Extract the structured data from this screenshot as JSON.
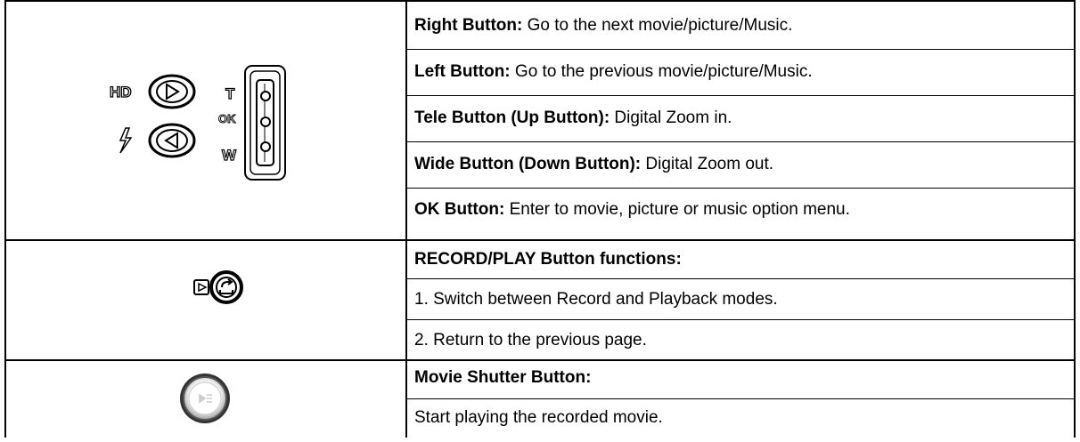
{
  "rows": [
    {
      "icon": {
        "hd_label": "HD",
        "t_label": "T",
        "ok_label": "OK",
        "w_label": "W"
      },
      "lines": [
        {
          "label": "Right Button:",
          "text": " Go to the next movie/picture/Music."
        },
        {
          "label": "Left Button:",
          "text": " Go to the previous movie/picture/Music."
        },
        {
          "label": "Tele Button (Up Button):",
          "text": " Digital Zoom in."
        },
        {
          "label": "Wide Button (Down Button):",
          "text": " Digital Zoom out."
        },
        {
          "label": "OK Button:",
          "text": " Enter to movie, picture or music option menu."
        }
      ]
    },
    {
      "lines": [
        {
          "label": "RECORD/PLAY Button functions:",
          "text": ""
        },
        {
          "label": "",
          "text": "1. Switch between Record and Playback modes."
        },
        {
          "label": "",
          "text": "2. Return to the previous page."
        }
      ]
    },
    {
      "lines": [
        {
          "label": "Movie Shutter Button:",
          "text": ""
        },
        {
          "label": "",
          "text": "Start playing the recorded movie."
        }
      ]
    }
  ]
}
